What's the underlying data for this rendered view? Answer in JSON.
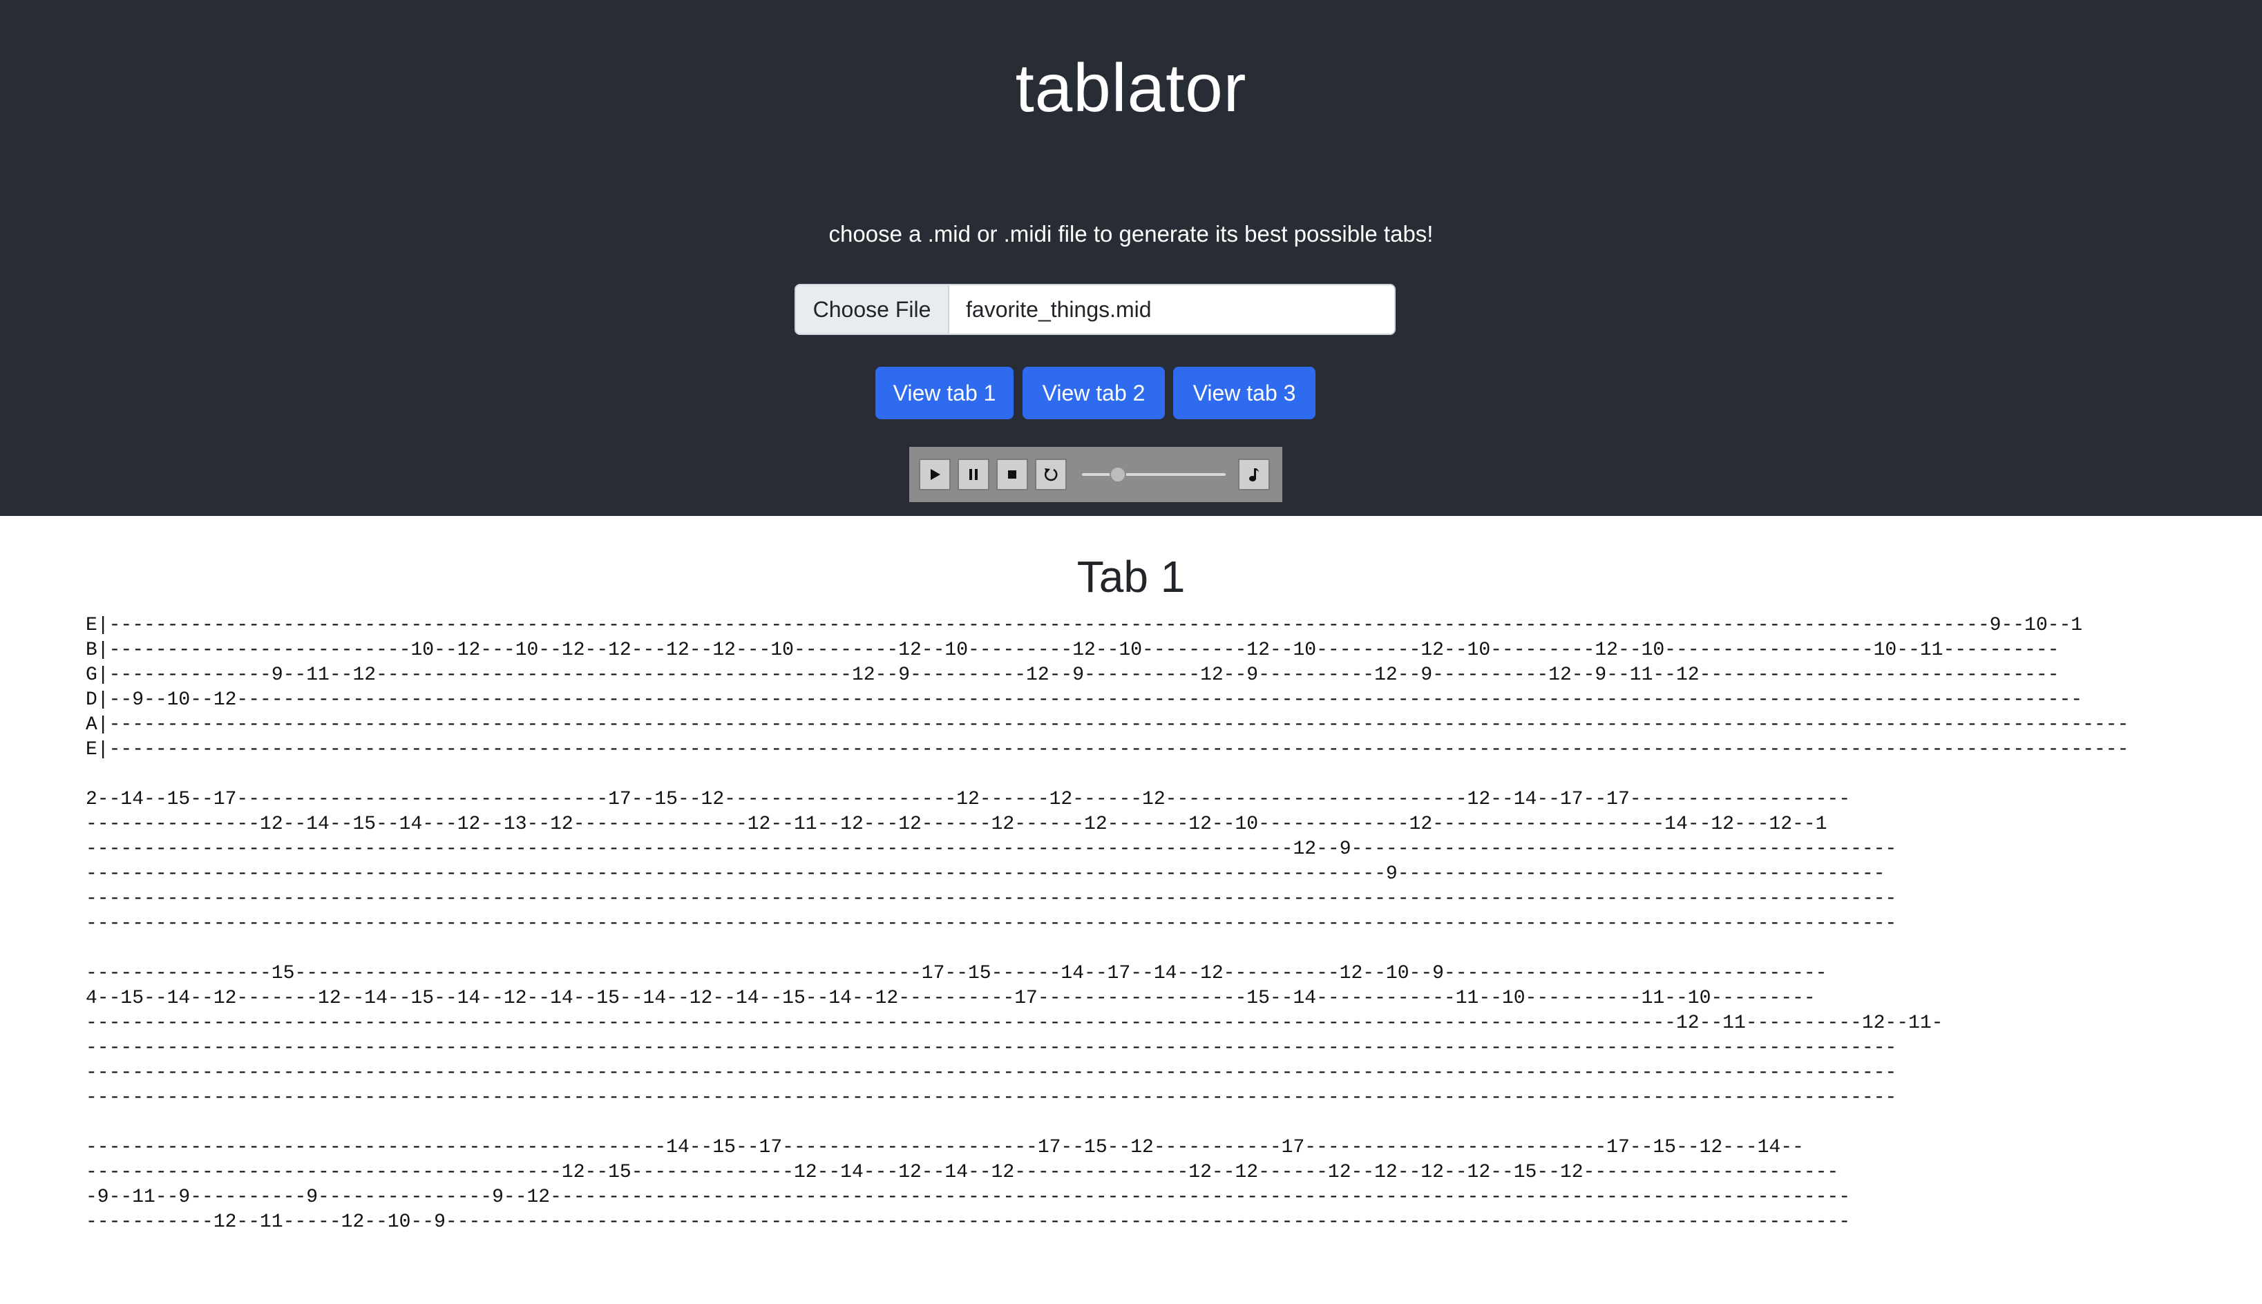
{
  "header": {
    "title": "tablator",
    "instructions": "choose a .mid or .midi file to generate its best possible tabs!"
  },
  "file_input": {
    "button_label": "Choose File",
    "file_name": "favorite_things.mid"
  },
  "tab_buttons": [
    {
      "label": "View tab 1"
    },
    {
      "label": "View tab 2"
    },
    {
      "label": "View tab 3"
    }
  ],
  "player": {
    "controls": [
      "play-icon",
      "pause-icon",
      "stop-icon",
      "replay-icon",
      "music-note-icon"
    ],
    "position_fraction": 0.25
  },
  "tab": {
    "heading": "Tab 1",
    "content": "E|------------------------------------------------------------------------------------------------------------------------------------------------------------------9--10--1\nB|--------------------------10--12---10--12--12---12--12---10---------12--10---------12--10---------12--10---------12--10---------12--10------------------10--11----------\nG|--------------9--11--12-----------------------------------------12--9----------12--9----------12--9----------12--9----------12--9--11--12-------------------------------\nD|--9--10--12---------------------------------------------------------------------------------------------------------------------------------------------------------------\nA|------------------------------------------------------------------------------------------------------------------------------------------------------------------------------\nE|------------------------------------------------------------------------------------------------------------------------------------------------------------------------------\n\n2--14--15--17--------------------------------17--15--12--------------------12------12------12--------------------------12--14--17--17-------------------\n---------------12--14--15--14---12--13--12---------------12--11--12---12------12------12-------12--10-------------12--------------------14--12---12--1\n--------------------------------------------------------------------------------------------------------12--9-----------------------------------------------\n----------------------------------------------------------------------------------------------------------------9------------------------------------------\n------------------------------------------------------------------------------------------------------------------------------------------------------------\n------------------------------------------------------------------------------------------------------------------------------------------------------------\n\n----------------15------------------------------------------------------17--15------14--17--14--12----------12--10--9---------------------------------\n4--15--14--12-------12--14--15--14--12--14--15--14--12--14--15--14--12----------17------------------15--14------------11--10----------11--10---------\n-----------------------------------------------------------------------------------------------------------------------------------------12--11----------12--11-\n------------------------------------------------------------------------------------------------------------------------------------------------------------\n------------------------------------------------------------------------------------------------------------------------------------------------------------\n------------------------------------------------------------------------------------------------------------------------------------------------------------\n\n--------------------------------------------------14--15--17----------------------17--15--12-----------17--------------------------17--15--12---14--\n-----------------------------------------12--15--------------12--14---12--14--12---------------12--12------12--12--12--12--15--12----------------------\n-9--11--9----------9---------------9--12----------------------------------------------------------------------------------------------------------------\n-----------12--11-----12--10--9-------------------------------------------------------------------------------------------------------------------------"
  }
}
